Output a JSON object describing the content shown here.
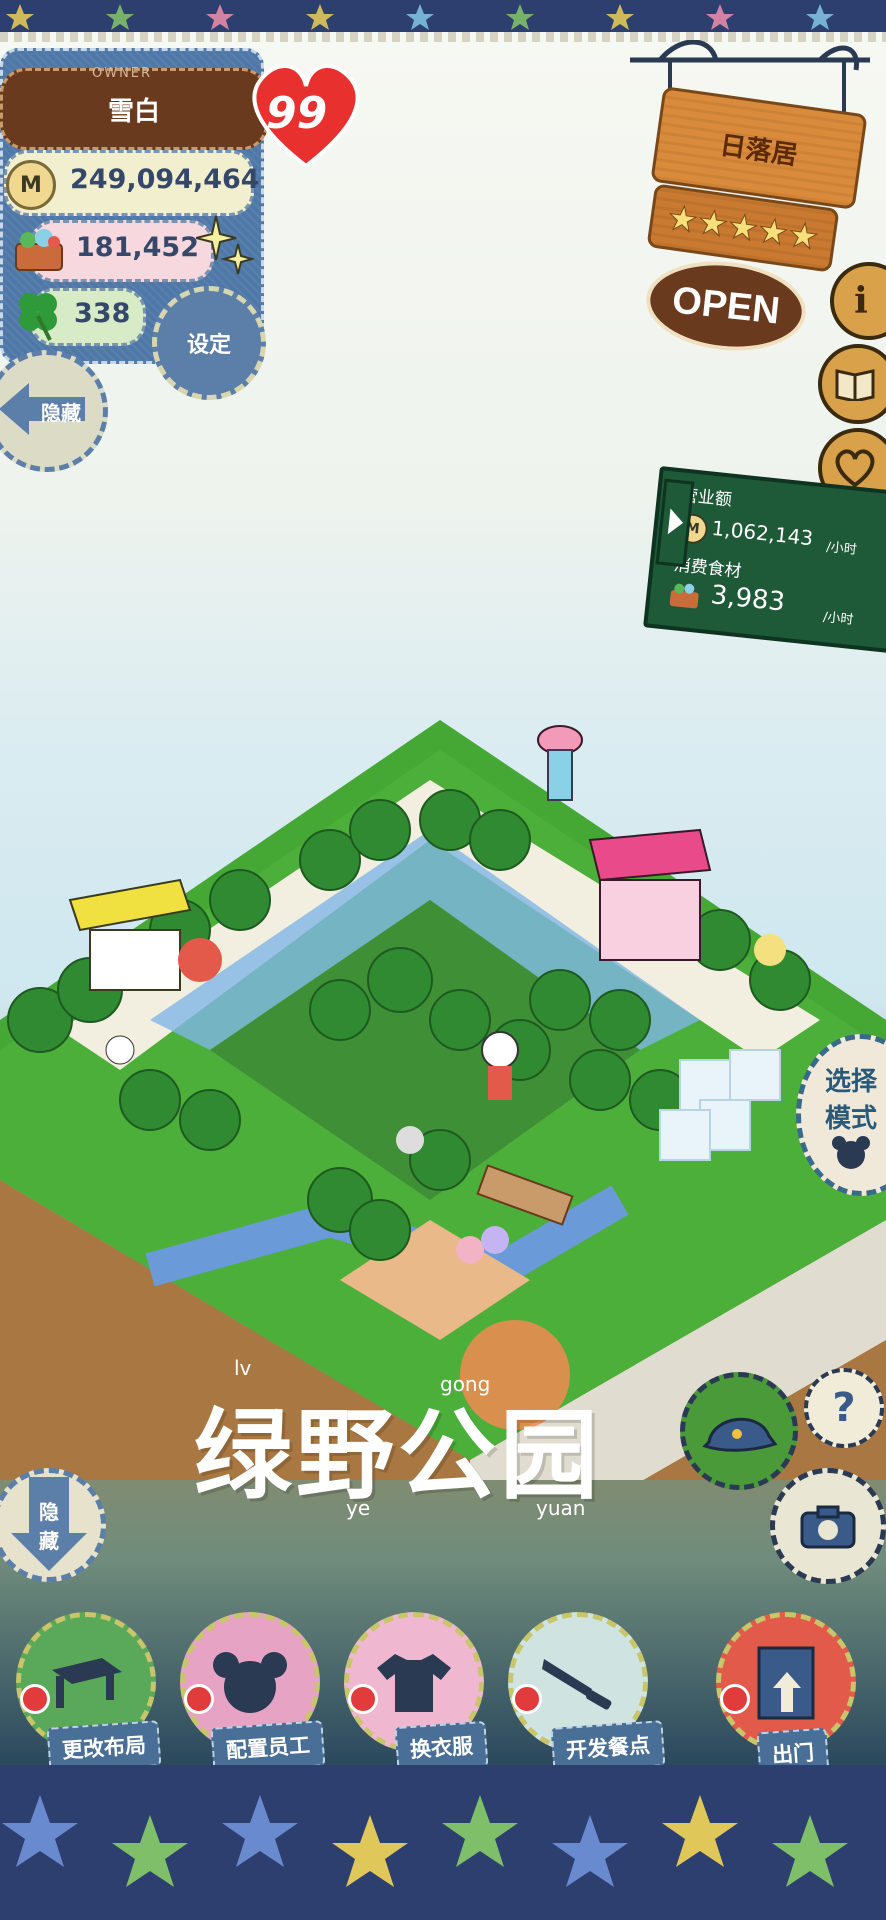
{
  "owner": {
    "label": "OWNER",
    "name": "雪白",
    "hearts": "99",
    "coins": "249,094,464",
    "ingredients": "181,452",
    "clover": "338"
  },
  "buttons": {
    "settings": "设定",
    "hide_top": "隐藏",
    "hide_bottom_line1": "隐",
    "hide_bottom_line2": "藏",
    "mode_line1": "选择",
    "mode_line2": "模式",
    "help": "?"
  },
  "shop": {
    "name": "日落居",
    "rating": 5,
    "status": "OPEN",
    "stars": [
      "★",
      "★",
      "★",
      "★",
      "★"
    ]
  },
  "stats": {
    "revenue_label": "营业额",
    "revenue_value": "1,062,143",
    "revenue_unit": "/小时",
    "food_label": "消费食材",
    "food_value": "3,983",
    "food_unit": "/小时"
  },
  "area": {
    "title": "绿野公园",
    "pinyin": [
      "lv",
      "ye",
      "gong",
      "yuan"
    ]
  },
  "bottom_bar": [
    {
      "label": "更改布局",
      "icon": "table-icon",
      "bg": "#5aa85a"
    },
    {
      "label": "配置员工",
      "icon": "bear-head-icon",
      "bg": "#e6a3c4"
    },
    {
      "label": "换衣服",
      "icon": "shirt-icon",
      "bg": "#f0b8d0"
    },
    {
      "label": "开发餐点",
      "icon": "knife-icon",
      "bg": "#cfe4e0"
    },
    {
      "label": "出门",
      "icon": "door-icon",
      "bg": "#e25a4a"
    }
  ],
  "colors": {
    "grass": "#4caf3a",
    "denim": "#4f78a8",
    "board_green": "#1f5a38",
    "wood": "#d98a3a",
    "heart_red": "#e8302f"
  }
}
